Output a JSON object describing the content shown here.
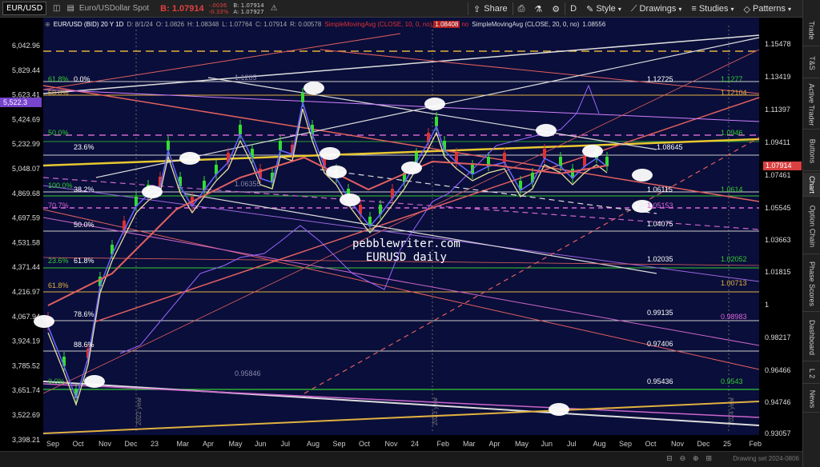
{
  "toolbar": {
    "symbol": "EUR/USD",
    "description": "Euro/USDollar Spot",
    "bid_prefix": "B:",
    "bid_value": "1.07914",
    "change": "-.0036",
    "change_pct": "-0.33%",
    "bid_small": "B: 1.07914",
    "ask_small": "A: 1.07927",
    "share": "Share",
    "period": "D",
    "style": "Style",
    "drawings": "Drawings",
    "studies": "Studies",
    "patterns": "Patterns"
  },
  "study_line": {
    "name": "EUR/USD (BID) 20 Y 1D",
    "date": "D: 8/1/24",
    "open": "O: 1.0826",
    "high": "H: 1.08348",
    "low": "L: 1.07764",
    "close": "C: 1.07914",
    "range": "R: 0.00578",
    "sma1": "SimpleMovingAvg (CLOSE, 10, 0, no)",
    "sma1_value": "1.08408",
    "no_label": "no",
    "sma2": "SimpleMovingAvg (CLOSE, 20, 0, no)",
    "sma2_value": "1.08556"
  },
  "watermark": {
    "line1": "pebblewriter.com",
    "line2": "EURUSD daily"
  },
  "right_axis": [
    "1.15478",
    "1.13419",
    "1.11397",
    "1.09411",
    "1.07461",
    "1.05545",
    "1.03663",
    "1.01815",
    "1",
    "0.98217",
    "0.96466",
    "0.94746",
    "0.93057"
  ],
  "left_axis": [
    "6,042.96",
    "5,829.44",
    "5,623.41",
    "5,424.69",
    "5,232.99",
    "5,048.07",
    "4,869.68",
    "4,697.59",
    "4,531.58",
    "4,371.44",
    "4,216.97",
    "4,067.94",
    "3,924.19",
    "3,785.52",
    "3,651.74",
    "3,522.69",
    "3,398.21"
  ],
  "left_tag": "5,522.3",
  "x_axis": [
    "Sep",
    "Oct",
    "Nov",
    "Dec",
    "23",
    "Mar",
    "Apr",
    "May",
    "Jun",
    "Jul",
    "Aug",
    "Sep",
    "Oct",
    "Nov",
    "24",
    "Feb",
    "Mar",
    "Apr",
    "May",
    "Jun",
    "Jul",
    "Aug",
    "Sep",
    "Oct",
    "Nov",
    "Dec",
    "25",
    "Feb"
  ],
  "year_labels": [
    "2022 year",
    "2023 year",
    "2024 year"
  ],
  "price_tags": [
    {
      "text": "1.07914",
      "color": "#d94040"
    }
  ],
  "fib_labels": [
    {
      "text": "1.1285",
      "color": "#8888aa"
    },
    {
      "text": "1.12725",
      "color": "#ffffff"
    },
    {
      "text": "1.1277",
      "color": "#33cc33"
    },
    {
      "text": "1.12104",
      "color": "#e0b040"
    },
    {
      "text": "1.0946",
      "color": "#33cc33"
    },
    {
      "text": "1.08645",
      "color": "#ffffff"
    },
    {
      "text": "1.06355",
      "color": "#8888aa"
    },
    {
      "text": "1.06115",
      "color": "#ffffff"
    },
    {
      "text": "1.0614",
      "color": "#33cc33"
    },
    {
      "text": "1.05153",
      "color": "#dd66dd"
    },
    {
      "text": "1.04075",
      "color": "#ffffff"
    },
    {
      "text": "1.02035",
      "color": "#ffffff"
    },
    {
      "text": "1.02052",
      "color": "#33cc33"
    },
    {
      "text": "1.00713",
      "color": "#e0b040"
    },
    {
      "text": "0.99135",
      "color": "#ffffff"
    },
    {
      "text": "0.98983",
      "color": "#dd66dd"
    },
    {
      "text": "0.97406",
      "color": "#ffffff"
    },
    {
      "text": "0.95846",
      "color": "#8888aa"
    },
    {
      "text": "0.95436",
      "color": "#ffffff"
    },
    {
      "text": "0.9543",
      "color": "#33cc33"
    }
  ],
  "pct_labels": [
    {
      "text": "61.8%",
      "color": "#33cc33"
    },
    {
      "text": "0.0%",
      "color": "#ffffff"
    },
    {
      "text": "50.0%",
      "color": "#e0b040"
    },
    {
      "text": "50.0%",
      "color": "#33cc33"
    },
    {
      "text": "23.6%",
      "color": "#ffffff"
    },
    {
      "text": "100.0%",
      "color": "#33cc33"
    },
    {
      "text": "38.2%",
      "color": "#ffffff"
    },
    {
      "text": "70.7%",
      "color": "#dd66dd"
    },
    {
      "text": "50.0%",
      "color": "#ffffff"
    },
    {
      "text": "23.6%",
      "color": "#33cc33"
    },
    {
      "text": "61.8%",
      "color": "#ffffff"
    },
    {
      "text": "61.8%",
      "color": "#e0b040"
    },
    {
      "text": "78.6%",
      "color": "#ffffff"
    },
    {
      "text": "88.6%",
      "color": "#ffffff"
    },
    {
      "text": "0.0%",
      "color": "#33cc33"
    }
  ],
  "sidebar": [
    "Trade",
    "T&S",
    "Active Trader",
    "Buttons",
    "Chart",
    "Option Chain",
    "Phase Scores",
    "Dashboard",
    "L 2",
    "News"
  ],
  "sidebar_active": "Chart",
  "footer": {
    "drawing_set": "Drawing set 2024-0806"
  },
  "colors": {
    "bg": "#0a0e3a",
    "bid": "#e04040",
    "accent": "#f0c020"
  }
}
